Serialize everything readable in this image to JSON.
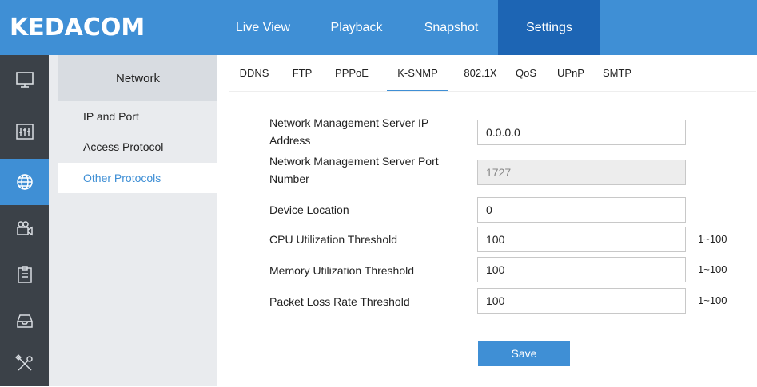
{
  "brand": {
    "logo_text": "KEDACOM"
  },
  "top_nav": [
    {
      "label": "Live View",
      "active": false
    },
    {
      "label": "Playback",
      "active": false
    },
    {
      "label": "Snapshot",
      "active": false
    },
    {
      "label": "Settings",
      "active": true
    }
  ],
  "rail": [
    {
      "icon": "monitor-icon",
      "active": false
    },
    {
      "icon": "sliders-icon",
      "active": false
    },
    {
      "icon": "network-globe-icon",
      "active": true
    },
    {
      "icon": "camera-icon",
      "active": false
    },
    {
      "icon": "clipboard-icon",
      "active": false
    },
    {
      "icon": "storage-tray-icon",
      "active": false
    },
    {
      "icon": "tools-icon",
      "active": false
    }
  ],
  "submenu": {
    "title": "Network",
    "items": [
      {
        "label": "IP and Port",
        "active": false
      },
      {
        "label": "Access Protocol",
        "active": false
      },
      {
        "label": "Other Protocols",
        "active": true
      }
    ]
  },
  "tabs": [
    {
      "label": "DDNS",
      "active": false
    },
    {
      "label": "FTP",
      "active": false
    },
    {
      "label": "PPPoE",
      "active": false
    },
    {
      "label": "K-SNMP",
      "active": true
    },
    {
      "label": "802.1X",
      "active": false
    },
    {
      "label": "QoS",
      "active": false
    },
    {
      "label": "UPnP",
      "active": false
    },
    {
      "label": "SMTP",
      "active": false
    }
  ],
  "form": {
    "server_ip": {
      "label_line1": "Network Management Server IP",
      "label_line2": "Address",
      "value": "0.0.0.0"
    },
    "server_port": {
      "label_line1": "Network Management Server Port",
      "label_line2": "Number",
      "value": "1727"
    },
    "device_location": {
      "label": "Device Location",
      "value": "0"
    },
    "cpu_threshold": {
      "label": "CPU Utilization Threshold",
      "value": "100",
      "range": "1~100"
    },
    "memory_threshold": {
      "label": "Memory Utilization Threshold",
      "value": "100",
      "range": "1~100"
    },
    "packet_loss_threshold": {
      "label": "Packet Loss Rate Threshold",
      "value": "100",
      "range": "1~100"
    },
    "save_label": "Save"
  },
  "colors": {
    "accent": "#3f8fd5",
    "accent_dark": "#1d65b4",
    "rail_bg": "#3b4148",
    "submenu_bg": "#e9ebee"
  }
}
